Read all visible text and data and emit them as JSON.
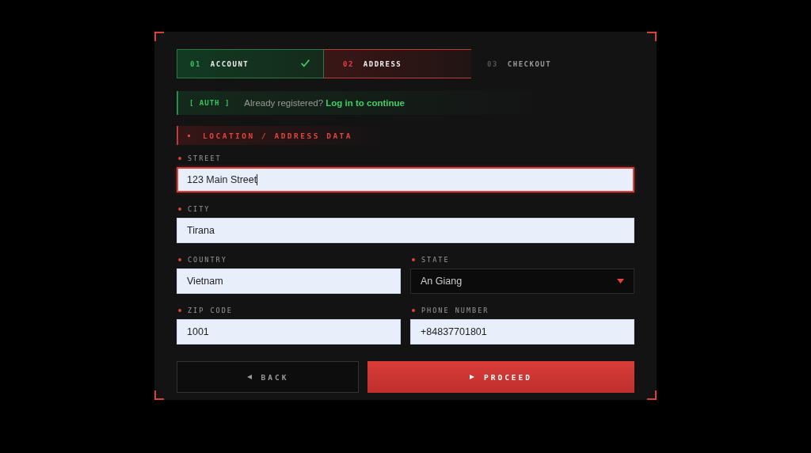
{
  "steps": [
    {
      "number": "01",
      "label": "ACCOUNT",
      "completed": true,
      "selected": false
    },
    {
      "number": "02",
      "label": "ADDRESS",
      "completed": false,
      "selected": true
    },
    {
      "number": "03",
      "label": "CHECKOUT",
      "completed": false,
      "selected": false
    }
  ],
  "auth": {
    "tag": "[ AUTH ]",
    "text": "Already registered?",
    "link": "Log in to continue"
  },
  "section": {
    "title": "LOCATION / ADDRESS DATA"
  },
  "field_rows": [
    [
      {
        "kind": "text",
        "label": "STREET",
        "value": "123 Main Street",
        "focused": true
      }
    ],
    [
      {
        "kind": "text",
        "label": "CITY",
        "value": "Tirana",
        "focused": false
      }
    ],
    [
      {
        "kind": "text",
        "label": "COUNTRY",
        "value": "Vietnam",
        "focused": false
      },
      {
        "kind": "select",
        "label": "STATE",
        "value": "An Giang",
        "focused": false
      }
    ],
    [
      {
        "kind": "text",
        "label": "ZIP CODE",
        "value": "1001",
        "focused": false
      },
      {
        "kind": "text",
        "label": "PHONE NUMBER",
        "value": "+84837701801",
        "focused": false
      }
    ]
  ],
  "buttons": [
    {
      "kind": "back",
      "label": "BACK"
    },
    {
      "kind": "primary",
      "label": "PROCEED"
    }
  ]
}
